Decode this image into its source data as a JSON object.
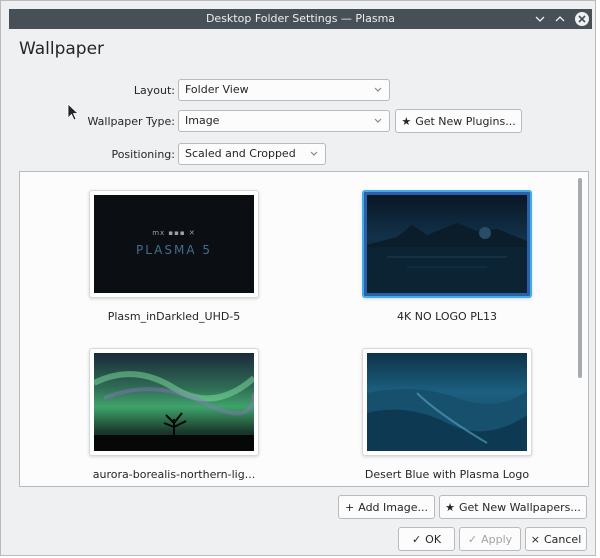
{
  "window": {
    "title": "Desktop Folder Settings — Plasma"
  },
  "heading": "Wallpaper",
  "form": {
    "layout_label": "Layout:",
    "layout_value": "Folder View",
    "type_label": "Wallpaper Type:",
    "type_value": "Image",
    "get_plugins_label": "Get New Plugins...",
    "positioning_label": "Positioning:",
    "positioning_value": "Scaled and Cropped"
  },
  "wallpapers": [
    {
      "caption": "Plasm_inDarkled_UHD-5",
      "logo_top": "mx ▪▪▪ ✕",
      "logo_main": "PLASMA 5",
      "selected": false
    },
    {
      "caption": "4K NO LOGO PL13",
      "selected": true
    },
    {
      "caption": "aurora-borealis-northern-lig...",
      "selected": false
    },
    {
      "caption": "Desert Blue with Plasma Logo",
      "selected": false
    }
  ],
  "actions": {
    "add_image_label": "Add Image...",
    "get_wallpapers_label": "Get New Wallpapers...",
    "ok_label": "OK",
    "apply_label": "Apply",
    "cancel_label": "Cancel"
  },
  "colors": {
    "titlebar": "#475057",
    "selection": "#3daee9",
    "window_bg": "#eff0f1"
  }
}
